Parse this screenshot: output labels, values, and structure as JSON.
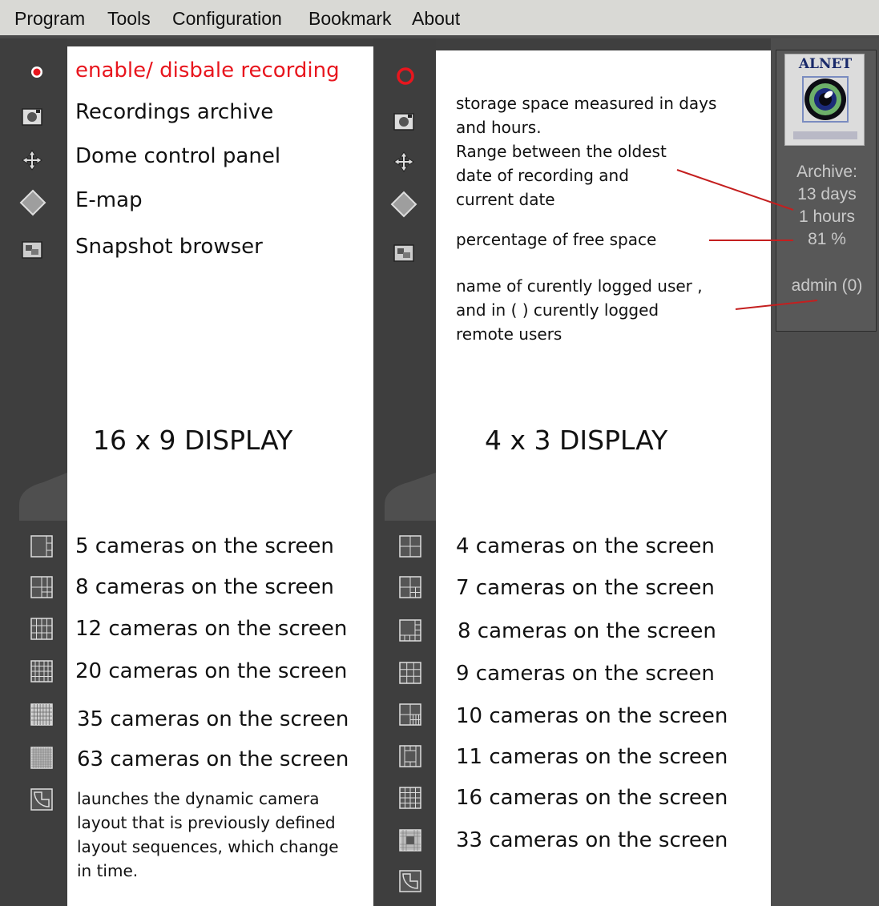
{
  "menu": [
    "Program",
    "Tools",
    "Configuration",
    "Bookmark",
    "About"
  ],
  "left_panel": {
    "buttons": [
      "enable/ disbale recording",
      "Recordings archive",
      "Dome control panel",
      "E-map",
      "Snapshot browser"
    ],
    "heading": "16 x 9 DISPLAY",
    "layouts": [
      "5 cameras on the screen",
      "8 cameras on the screen",
      "12 cameras on the screen",
      "20 cameras on the screen",
      "35 cameras on the screen",
      "63 cameras on the screen"
    ],
    "dynamic_layout": [
      "launches the dynamic camera",
      "layout that is previously defined",
      "layout sequences, which change",
      "in time."
    ]
  },
  "right_panel": {
    "storage_note": [
      "storage space measured in days",
      "and hours.",
      "Range between the oldest",
      "date of recording and",
      "current date"
    ],
    "free_space_note": "percentage of free space",
    "user_note": [
      "name of curently logged user ,",
      "and in ( ) curently logged",
      "remote users"
    ],
    "heading": "4 x 3 DISPLAY",
    "layouts": [
      "4 cameras on the screen",
      "7 cameras on the screen",
      "8 cameras on the screen",
      "9 cameras on the screen",
      "10 cameras on the screen",
      "11 cameras on the screen",
      "16 cameras on the screen",
      "33 cameras on the screen"
    ]
  },
  "status_panel": {
    "logo_text": "ALNET",
    "archive_label": "Archive:",
    "archive_days": "13 days",
    "archive_hours": "1 hours",
    "free_space": "81 %",
    "user": "admin (0)"
  },
  "colors": {
    "accent_red": "#e8161e",
    "annotation_line": "#c41f1f",
    "status_text": "#c9c9c9"
  }
}
